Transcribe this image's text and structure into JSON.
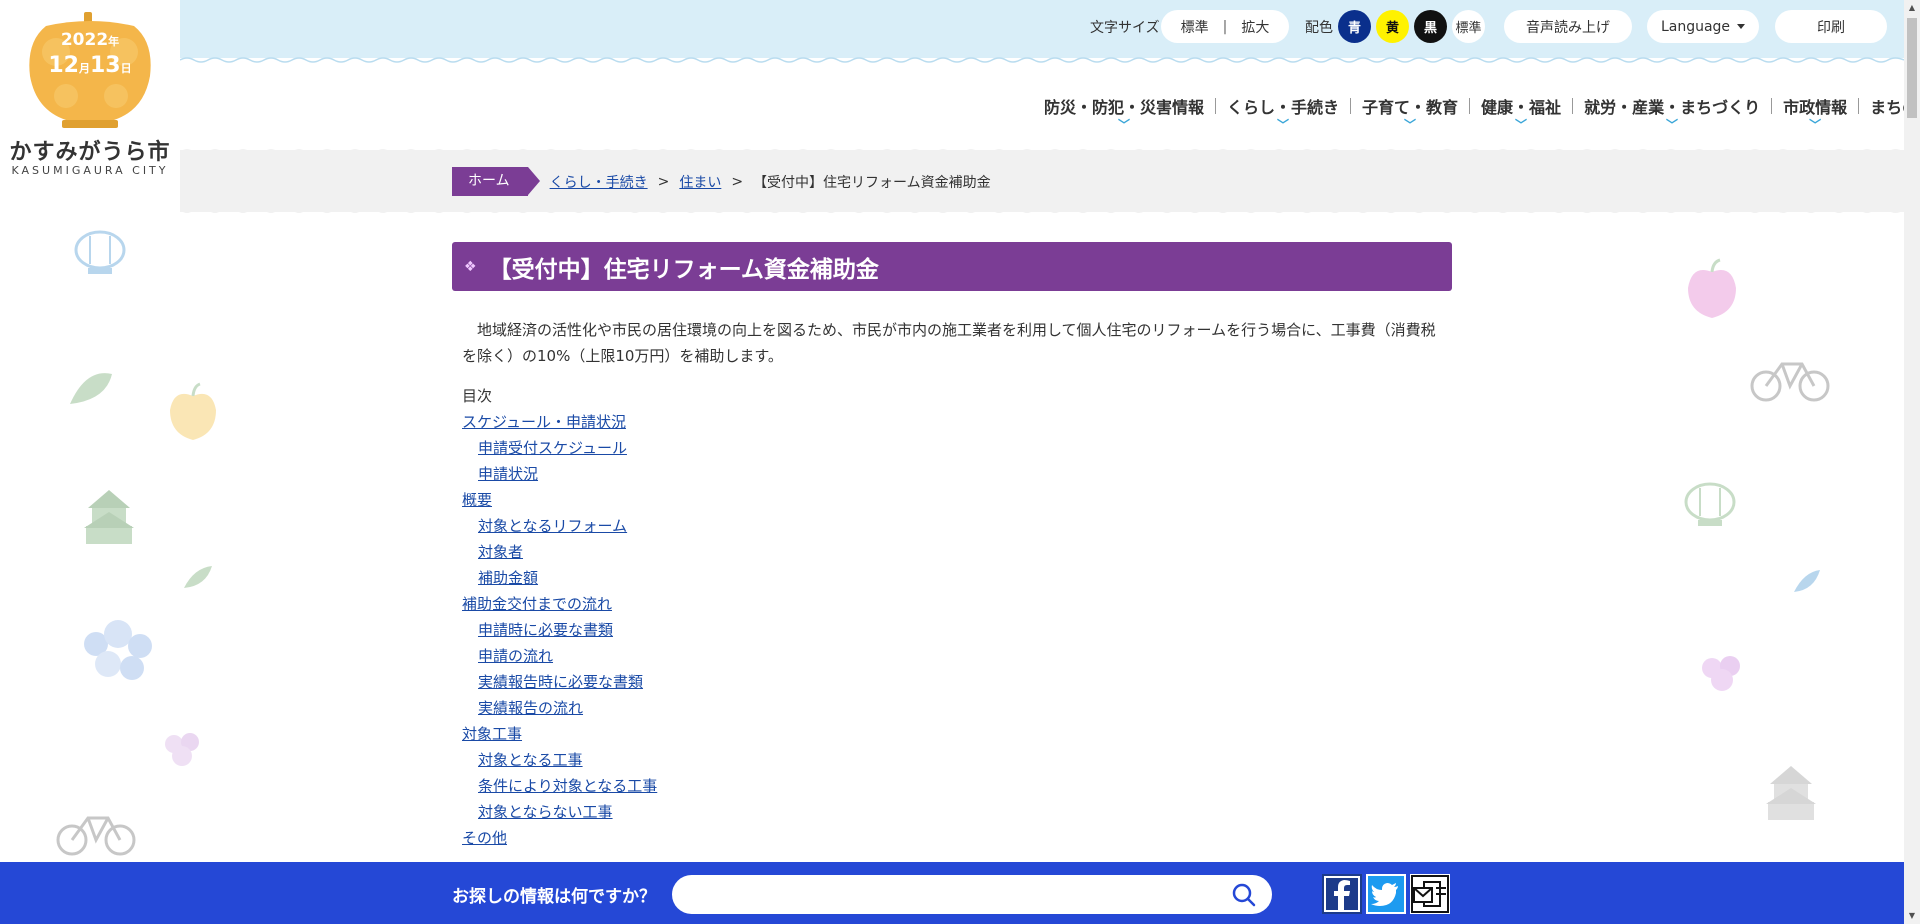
{
  "logo": {
    "year": "2022",
    "year_suffix": "年",
    "month": "12",
    "month_suffix": "月",
    "day": "13",
    "day_suffix": "日",
    "name": "かすみがうら市",
    "sub": "KASUMIGAURA CITY"
  },
  "utility": {
    "font_size_label": "文字サイズ",
    "font_standard": "標準",
    "font_divider": "|",
    "font_large": "拡大",
    "color_label": "配色",
    "color_blue": "青",
    "color_yellow": "黄",
    "color_black": "黒",
    "color_standard": "標準",
    "speech": "音声読み上げ",
    "language": "Language",
    "print": "印刷"
  },
  "gnav": {
    "items": [
      {
        "label": "防災・防犯・災害情報"
      },
      {
        "label": "くらし・手続き"
      },
      {
        "label": "子育て・教育"
      },
      {
        "label": "健康・福祉"
      },
      {
        "label": "就労・産業・まちづくり"
      },
      {
        "label": "市政情報"
      },
      {
        "label": "まちの魅力"
      }
    ],
    "chevron": "﹀"
  },
  "breadcrumb": {
    "home": "ホーム",
    "level1": "くらし・手続き",
    "level2": "住まい",
    "separator": ">",
    "current": "【受付中】住宅リフォーム資金補助金"
  },
  "page": {
    "title_marker": "❖",
    "title": "【受付中】住宅リフォーム資金補助金",
    "lead": "地域経済の活性化や市民の居住環境の向上を図るため、市民が市内の施工業者を利用して個人住宅のリフォームを行う場合に、工事費（消費税を除く）の10%（上限10万円）を補助します。"
  },
  "toc": {
    "heading": "目次",
    "items": [
      {
        "label": "スケジュール・申請状況",
        "level": 1
      },
      {
        "label": "申請受付スケジュール",
        "level": 2
      },
      {
        "label": "申請状況",
        "level": 2
      },
      {
        "label": "概要",
        "level": 1
      },
      {
        "label": "対象となるリフォーム",
        "level": 2
      },
      {
        "label": "対象者",
        "level": 2
      },
      {
        "label": "補助金額",
        "level": 2
      },
      {
        "label": "補助金交付までの流れ",
        "level": 1
      },
      {
        "label": "申請時に必要な書類",
        "level": 2
      },
      {
        "label": "申請の流れ",
        "level": 2
      },
      {
        "label": "実績報告時に必要な書類",
        "level": 2
      },
      {
        "label": "実績報告の流れ",
        "level": 2
      },
      {
        "label": "対象工事",
        "level": 1
      },
      {
        "label": "対象となる工事",
        "level": 2
      },
      {
        "label": "条件により対象となる工事",
        "level": 2
      },
      {
        "label": "対象とならない工事",
        "level": 2
      },
      {
        "label": "その他",
        "level": 1
      }
    ]
  },
  "footer": {
    "search_prompt": "お探しの情報は何ですか？",
    "search_value": "",
    "search_placeholder": ""
  },
  "colors": {
    "accent_purple": "#7b3d95",
    "top_bar": "#d9eef8",
    "footer_blue": "#2548d6",
    "link": "#1a4aa6",
    "scheme_blue": "#0a2f8c",
    "scheme_yellow": "#fff200",
    "scheme_black": "#111111",
    "logo_orange": "#f4b64a"
  },
  "icons": {
    "search": "search-icon",
    "facebook": "facebook-icon",
    "twitter": "twitter-icon",
    "mail": "mail-icon"
  }
}
